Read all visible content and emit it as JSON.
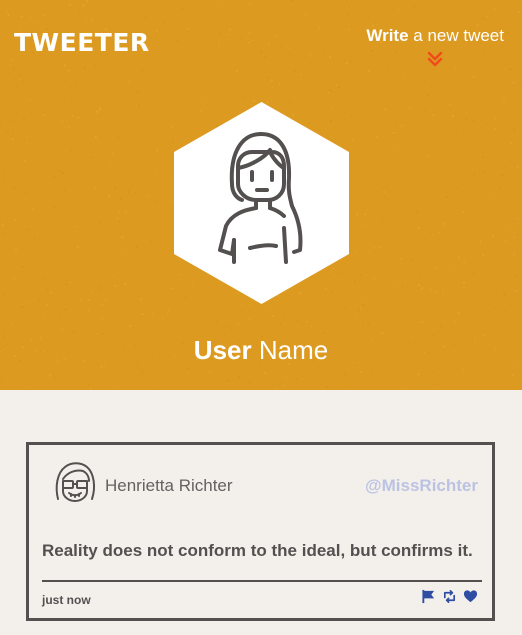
{
  "header": {
    "logo": "TWEETER",
    "compose_bold": "Write",
    "compose_rest": " a new tweet",
    "compose_icon": "double-chevron-down-icon",
    "accent": "#f04a1c",
    "background": "#dd9a20"
  },
  "profile": {
    "avatar_icon": "woman-avatar-icon",
    "name_bold": "User",
    "name_rest": " Name"
  },
  "tweet": {
    "author": "Henrietta Richter",
    "handle": "@MissRichter",
    "text": "Reality does not conform to the ideal, but confirms it.",
    "time": "just now",
    "actions": [
      "flag-icon",
      "retweet-icon",
      "heart-icon"
    ],
    "handle_color": "#bcc3e2",
    "action_color": "#2f4ea3"
  }
}
